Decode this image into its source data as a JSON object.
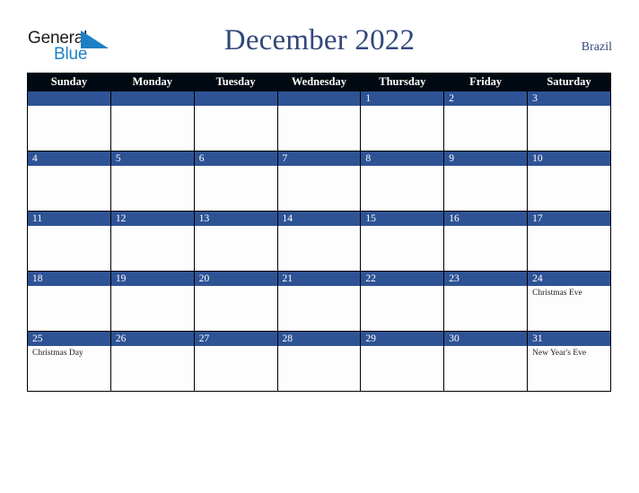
{
  "brand": {
    "line1": "General",
    "line2": "Blue",
    "triangle_color": "#1d7fc4",
    "line1_color": "#1a1a1a",
    "line2_color": "#1d7fc4"
  },
  "header": {
    "title": "December 2022",
    "country": "Brazil",
    "title_color": "#33487a"
  },
  "colors": {
    "header_row_bg": "#010912",
    "daynum_bg": "#2e5395",
    "cell_bg": "#fdfdfd",
    "grid_border": "#000000"
  },
  "calendar": {
    "weekday_headers": [
      "Sunday",
      "Monday",
      "Tuesday",
      "Wednesday",
      "Thursday",
      "Friday",
      "Saturday"
    ],
    "weeks": [
      [
        {
          "day": "",
          "event": ""
        },
        {
          "day": "",
          "event": ""
        },
        {
          "day": "",
          "event": ""
        },
        {
          "day": "",
          "event": ""
        },
        {
          "day": "1",
          "event": ""
        },
        {
          "day": "2",
          "event": ""
        },
        {
          "day": "3",
          "event": ""
        }
      ],
      [
        {
          "day": "4",
          "event": ""
        },
        {
          "day": "5",
          "event": ""
        },
        {
          "day": "6",
          "event": ""
        },
        {
          "day": "7",
          "event": ""
        },
        {
          "day": "8",
          "event": ""
        },
        {
          "day": "9",
          "event": ""
        },
        {
          "day": "10",
          "event": ""
        }
      ],
      [
        {
          "day": "11",
          "event": ""
        },
        {
          "day": "12",
          "event": ""
        },
        {
          "day": "13",
          "event": ""
        },
        {
          "day": "14",
          "event": ""
        },
        {
          "day": "15",
          "event": ""
        },
        {
          "day": "16",
          "event": ""
        },
        {
          "day": "17",
          "event": ""
        }
      ],
      [
        {
          "day": "18",
          "event": ""
        },
        {
          "day": "19",
          "event": ""
        },
        {
          "day": "20",
          "event": ""
        },
        {
          "day": "21",
          "event": ""
        },
        {
          "day": "22",
          "event": ""
        },
        {
          "day": "23",
          "event": ""
        },
        {
          "day": "24",
          "event": "Christmas Eve"
        }
      ],
      [
        {
          "day": "25",
          "event": "Christmas Day"
        },
        {
          "day": "26",
          "event": ""
        },
        {
          "day": "27",
          "event": ""
        },
        {
          "day": "28",
          "event": ""
        },
        {
          "day": "29",
          "event": ""
        },
        {
          "day": "30",
          "event": ""
        },
        {
          "day": "31",
          "event": "New Year's Eve"
        }
      ]
    ]
  }
}
